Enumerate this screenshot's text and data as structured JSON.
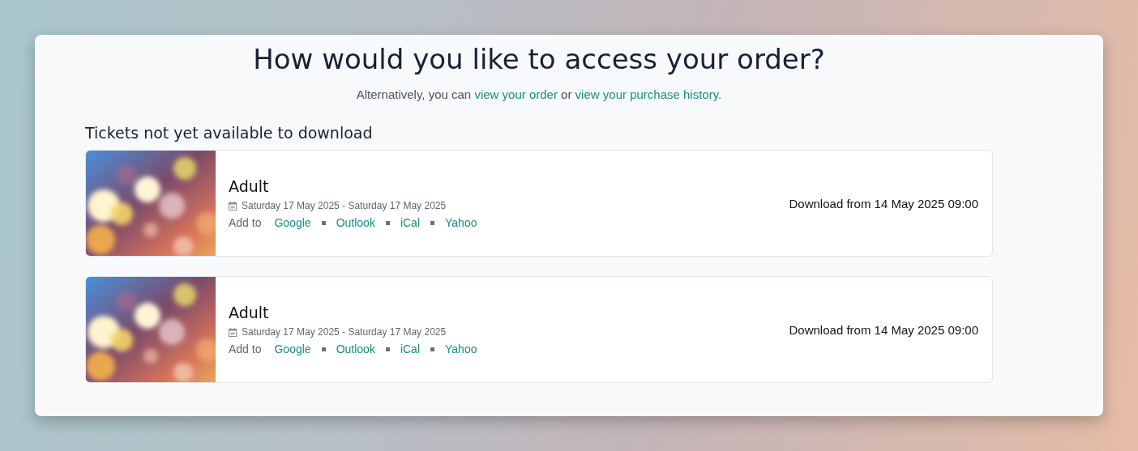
{
  "heading": "How would you like to access your order?",
  "intro": [
    {
      "kind": "text",
      "text": "Alternatively, you can "
    },
    {
      "kind": "link",
      "text": "view your order"
    },
    {
      "kind": "text",
      "text": " or "
    },
    {
      "kind": "link",
      "text": "view your purchase history."
    }
  ],
  "section_title": "Tickets not yet available to download",
  "tickets": [
    {
      "name": "Adult",
      "dates": "Saturday 17 May 2025 - Saturday 17 May 2025",
      "add_to_label": "Add to",
      "calendars": [
        "Google",
        "Outlook",
        "iCal",
        "Yahoo"
      ],
      "download_note": "Download from 14 May 2025 09:00"
    },
    {
      "name": "Adult",
      "dates": "Saturday 17 May 2025 - Saturday 17 May 2025",
      "add_to_label": "Add to",
      "calendars": [
        "Google",
        "Outlook",
        "iCal",
        "Yahoo"
      ],
      "download_note": "Download from 14 May 2025 09:00"
    }
  ]
}
